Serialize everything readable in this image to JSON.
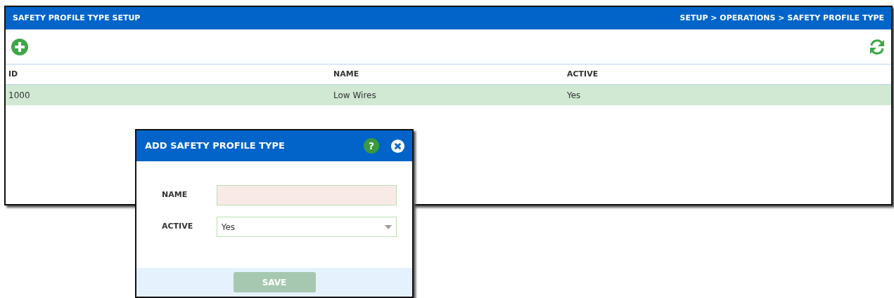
{
  "panel": {
    "title": "SAFETY PROFILE TYPE SETUP",
    "breadcrumb": "SETUP > OPERATIONS > SAFETY PROFILE TYPE"
  },
  "table": {
    "columns": [
      "ID",
      "NAME",
      "ACTIVE"
    ],
    "rows": [
      {
        "cells": [
          "1000",
          "Low Wires",
          "Yes"
        ],
        "selected": true
      }
    ]
  },
  "dialog": {
    "title": "ADD SAFETY PROFILE TYPE",
    "help_button": "?",
    "fields": [
      {
        "kind": "text",
        "label": "NAME",
        "invalid": true
      },
      {
        "kind": "select",
        "label": "ACTIVE",
        "value": "Yes",
        "invalid": false
      }
    ],
    "save_button": {
      "label": "SAVE",
      "disabled": true
    }
  }
}
